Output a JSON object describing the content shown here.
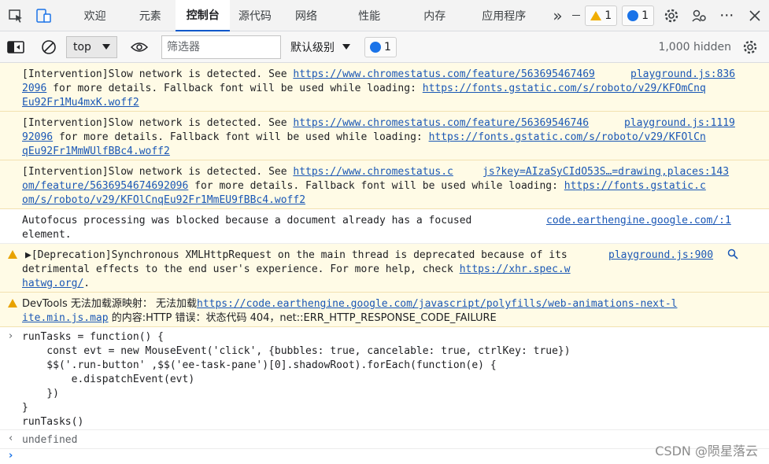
{
  "tabs": [
    {
      "label": "欢迎"
    },
    {
      "label": "元素"
    },
    {
      "label": "控制台"
    },
    {
      "label": "源代码"
    },
    {
      "label": "网络"
    },
    {
      "label": "性能"
    },
    {
      "label": "内存"
    },
    {
      "label": "应用程序"
    }
  ],
  "tab_more": "»",
  "badges": {
    "warnings": "1",
    "messages": "1"
  },
  "toolbar": {
    "context": "top",
    "filter_placeholder": "筛选器",
    "levels": "默认级别",
    "issues": "1",
    "hidden": "1,000 hidden"
  },
  "messages": [
    {
      "type": "warn",
      "l1a": "[Intervention]Slow network is detected. See ",
      "l1link": "https://www.chromestatus.com/feature/563695467469",
      "l1src": "playground.js:836",
      "l2src": "2096",
      "l2text": " for more details. Fallback font will be used while loading: ",
      "l2link": "https://fonts.gstatic.com/s/roboto/v29/KFOmCnq",
      "l3link": "Eu92Fr1Mu4mxK.woff2"
    },
    {
      "type": "warn",
      "l1a": "[Intervention]Slow network is detected. See ",
      "l1link": "https://www.chromestatus.com/feature/56369546746",
      "l1src": "playground.js:1119",
      "l2src": "92096",
      "l2text": " for more details. Fallback font will be used while loading: ",
      "l2link": "https://fonts.gstatic.com/s/roboto/v29/KFOlCn",
      "l3link": "qEu92Fr1MmWUlfBBc4.woff2"
    },
    {
      "type": "warn",
      "l1a": "[Intervention]Slow network is detected. See ",
      "l1link": "https://www.chromestatus.c",
      "l1src": "js?key=AIzaSyCIdO53S…=drawing,places:143",
      "l2link1": "om/feature/5636954674692096",
      "l2text": " for more details. Fallback font will be used while loading: ",
      "l2link": "https://fonts.gstatic.c",
      "l3link": "om/s/roboto/v29/KFOlCnqEu92Fr1MmEU9fBBc4.woff2"
    },
    {
      "type": "info",
      "l1": "Autofocus processing was blocked because a document already has a focused",
      "l1src": "code.earthengine.google.com/:1",
      "l2": "element."
    },
    {
      "type": "warn",
      "l1": "▶[Deprecation]Synchronous XMLHttpRequest on the main thread is deprecated because of its",
      "l1src": "playground.js:900",
      "l2text": "detrimental effects to the end user's experience. For more help, check ",
      "l2link": "https://xhr.spec.w",
      "l3link": "hatwg.org/",
      "l3tail": "."
    },
    {
      "type": "warn",
      "l1a": "DevTools 无法加载源映射： 无法加载",
      "l1link": "https://code.earthengine.google.com/javascript/polyfills/web-animations-next-l",
      "l2link": "ite.min.js.map",
      "l2text": " 的内容:HTTP 错误：状态代码 404，net::ERR_HTTP_RESPONSE_CODE_FAILURE"
    }
  ],
  "code": {
    "lines": [
      "runTasks = function() {",
      "    const evt = new MouseEvent('click', {bubbles: true, cancelable: true, ctrlKey: true})",
      "    $$('.run-button' ,$$('ee-task-pane')[0].shadowRoot).forEach(function(e) {",
      "        e.dispatchEvent(evt)",
      "    })",
      "}",
      "runTasks()"
    ],
    "result": "undefined"
  },
  "watermark": "CSDN @陨星落云"
}
